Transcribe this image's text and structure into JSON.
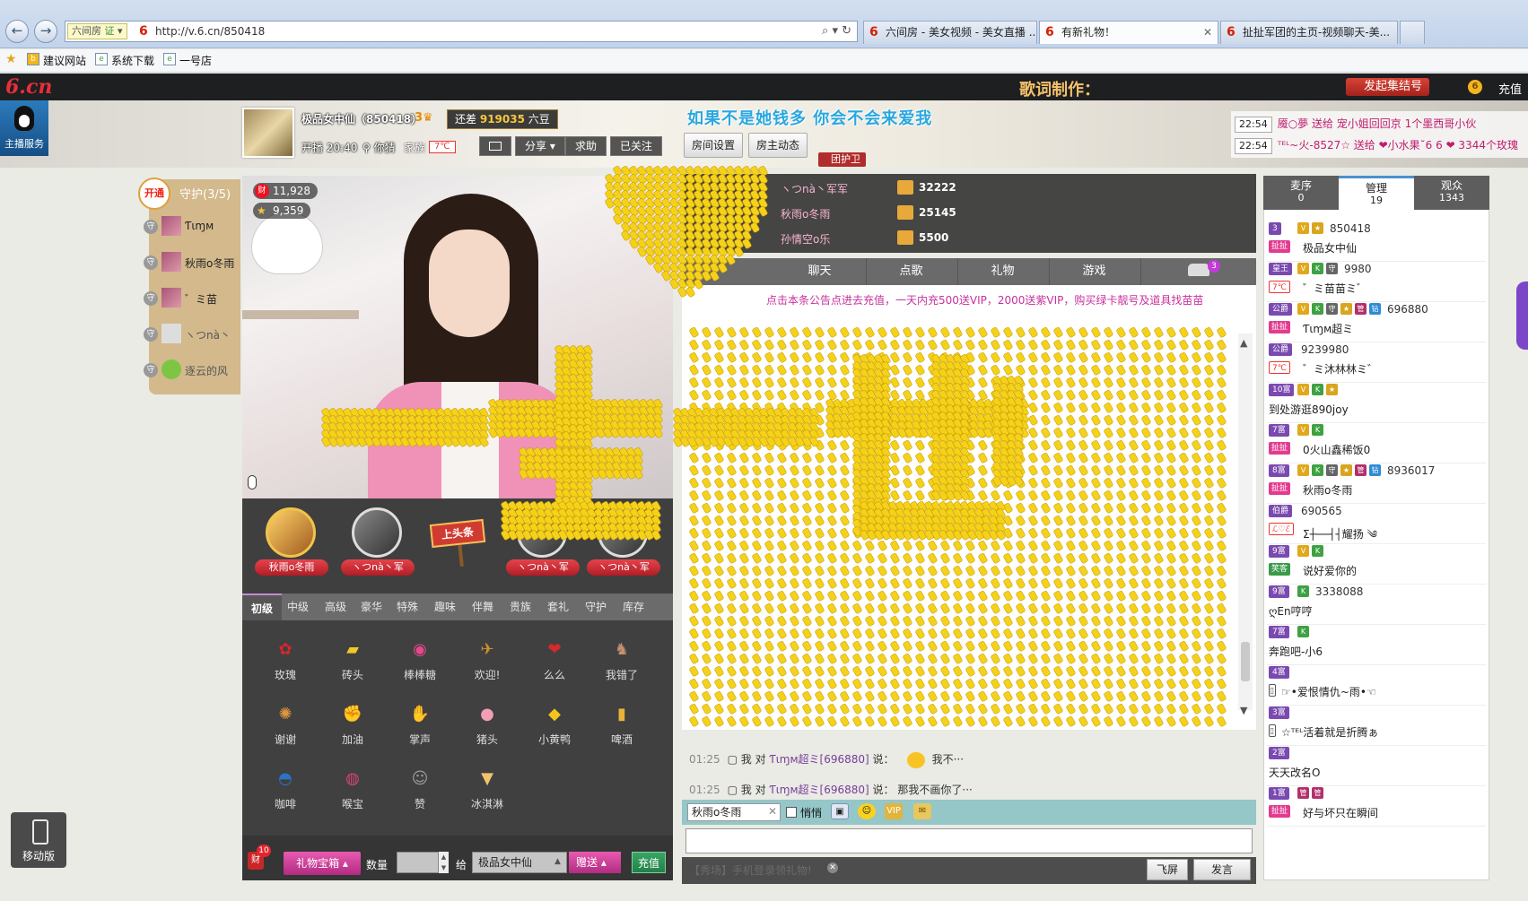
{
  "browser": {
    "site_badge": "六间房",
    "site_badge_extra": "证",
    "url": "http://v.6.cn/850418",
    "tabs": [
      {
        "title": "六间房 - 美女视频 - 美女直播 ...",
        "active": false
      },
      {
        "title": "有新礼物！",
        "active": true
      },
      {
        "title": "扯扯军团的主页-视频聊天-美...",
        "active": false
      }
    ],
    "favorites": [
      "建议网站",
      "系统下载",
      "一号店"
    ]
  },
  "header": {
    "logo": "6.cn",
    "lyrics_title": "歌词制作：",
    "rally_button": "发起集结号",
    "recharge": "充值"
  },
  "service_tab": "主播服务",
  "host": {
    "name": "极品女中仙（850418）",
    "level": "3",
    "gap_label": "还差",
    "gap_value": "919035",
    "gap_unit": "六豆",
    "live_time": "开播 20:40",
    "location": "你猜",
    "family_label": "家族",
    "family_badge": "7℃",
    "share": "分享",
    "ask": "求助",
    "followed": "已关注"
  },
  "marquee": "如果不是她钱多  你会不会来爱我",
  "room_buttons": {
    "settings": "房间设置",
    "dynamics": "房主动态",
    "guard": "团护卫"
  },
  "notices": [
    {
      "time": "22:54",
      "text": "魇○夢 送给 宠小姐回回京 1个墨西哥小伙"
    },
    {
      "time": "22:54",
      "text": "ᵀᴱᴸ~火-8527☆ 送给 ❤小水果˘6 6 ❤ 3344个玫瑰"
    }
  ],
  "guard": {
    "open": "开通",
    "title": "守护(3/5)",
    "members": [
      "Ƭιɱᴍ",
      "秋雨o冬雨",
      "゛ミ苗",
      "ヽつnà丶",
      "逐云的风"
    ]
  },
  "video_stats": {
    "wealth": "11,928",
    "stars": "9,359"
  },
  "rank_row": {
    "slots": [
      "秋雨o冬雨",
      "ヽつnà丶军",
      "ヽつnà丶军",
      "ヽつnà丶军"
    ],
    "headline": "上头条"
  },
  "gift_tabs": [
    "初级",
    "中级",
    "高级",
    "豪华",
    "特殊",
    "趣味",
    "伴舞",
    "贵族",
    "套礼",
    "守护",
    "库存"
  ],
  "gifts": [
    {
      "label": "玫瑰",
      "icon": "rose-icon",
      "glyph": "✿",
      "color": "#d8262c"
    },
    {
      "label": "砖头",
      "icon": "brick-icon",
      "glyph": "▰",
      "color": "#f2c823"
    },
    {
      "label": "棒棒糖",
      "icon": "lollipop-icon",
      "glyph": "◉",
      "color": "#e7488b"
    },
    {
      "label": "欢迎!",
      "icon": "welcome-icon",
      "glyph": "✈",
      "color": "#d0912b"
    },
    {
      "label": "么么",
      "icon": "kiss-icon",
      "glyph": "❤",
      "color": "#d42a2a"
    },
    {
      "label": "我错了",
      "icon": "sorry-icon",
      "glyph": "♞",
      "color": "#c59070"
    },
    {
      "label": "谢谢",
      "icon": "thanks-icon",
      "glyph": "✺",
      "color": "#e0943d"
    },
    {
      "label": "加油",
      "icon": "cheer-icon",
      "glyph": "✊",
      "color": "#d53b2a"
    },
    {
      "label": "掌声",
      "icon": "applause-icon",
      "glyph": "✋",
      "color": "#e3b27a"
    },
    {
      "label": "猪头",
      "icon": "pig-icon",
      "glyph": "●",
      "color": "#f29eb4"
    },
    {
      "label": "小黄鸭",
      "icon": "duck-icon",
      "glyph": "◆",
      "color": "#f3c51c"
    },
    {
      "label": "啤酒",
      "icon": "beer-icon",
      "glyph": "▮",
      "color": "#e8b13a"
    },
    {
      "label": "咖啡",
      "icon": "coffee-icon",
      "glyph": "◓",
      "color": "#2b73c9"
    },
    {
      "label": "喉宝",
      "icon": "lozenge-icon",
      "glyph": "◍",
      "color": "#d8427b"
    },
    {
      "label": "赞",
      "icon": "thumbs-up-icon",
      "glyph": "☺",
      "color": "#9c9c9c"
    },
    {
      "label": "冰淇淋",
      "icon": "icecream-icon",
      "glyph": "▼",
      "color": "#f1c36d"
    }
  ],
  "gift_bar": {
    "red_count": "10",
    "red_icon": "财",
    "treasure": "礼物宝箱",
    "qty_label": "数量",
    "to_label": "给",
    "recipient": "极品女中仙",
    "send": "赠送",
    "recharge": "充值"
  },
  "contributors": [
    {
      "name": "ヽつnà丶军军",
      "value": "32222"
    },
    {
      "name": "秋雨o冬雨",
      "value": "25145"
    },
    {
      "name": "孙情空o乐",
      "value": "5500"
    }
  ],
  "chat_tabs": [
    "聊天",
    "点歌",
    "礼物",
    "游戏"
  ],
  "car_count": "3",
  "chat_notice": "点击本条公告点进去充值，一天内充500送VIP，2000送紫VIP，购买绿卡靓号及道具找苗苗",
  "chat_messages": [
    {
      "time": "01:25",
      "me": "我 对",
      "user": "Ƭιɱᴍ超ミ",
      "uid": "[696880]",
      "say": "说：",
      "text": "我不···",
      "emoji": true
    },
    {
      "time": "01:25",
      "me": "我 对",
      "user": "Ƭιɱᴍ超ミ",
      "uid": "[696880]",
      "say": "说：",
      "text": "那我不画你了···",
      "emoji": false
    }
  ],
  "input": {
    "target": "秋雨o冬雨",
    "whisper": "悄悄",
    "mobile_login": "【秀场】手机登录领礼物!",
    "flyscreen": "飞屏",
    "speak": "发言"
  },
  "gift_animation": {
    "caption": "一生一世"
  },
  "user_tabs": [
    {
      "label": "麦序",
      "count": "0"
    },
    {
      "label": "管理",
      "count": "19",
      "active": true
    },
    {
      "label": "观众",
      "count": "1343"
    }
  ],
  "users": [
    {
      "level": "3",
      "badges": [
        "V",
        "★"
      ],
      "uid": "850418",
      "family": "扯扯",
      "name": "极品女中仙"
    },
    {
      "level": "皇王",
      "badges": [
        "V",
        "K",
        "守"
      ],
      "uid": "9980",
      "family": "7℃",
      "name": "゛ミ苗苗ミ゛"
    },
    {
      "level": "公爵",
      "badges": [
        "V",
        "K",
        "守",
        "★",
        "管",
        "钻"
      ],
      "uid": "696880",
      "family": "扯扯",
      "name": "Ƭιɱᴍ超ミ"
    },
    {
      "level": "公爵",
      "badges": [],
      "uid": "9239980",
      "family": "7℃",
      "name": "゛ミ沐林林ミ゛"
    },
    {
      "level": "10富",
      "badges": [
        "V",
        "K",
        "★"
      ],
      "uid": "",
      "family": "",
      "name": "到处游逛890joy"
    },
    {
      "level": "7富",
      "badges": [
        "V",
        "K"
      ],
      "uid": "",
      "family": "扯扯",
      "name": "0火山鑫稀饭0"
    },
    {
      "level": "8富",
      "badges": [
        "V",
        "K",
        "守",
        "★",
        "管",
        "钻"
      ],
      "uid": "8936017",
      "family": "扯扯",
      "name": "秋雨o冬雨"
    },
    {
      "level": "伯爵",
      "badges": [],
      "uid": "690565",
      "family": "ℒ♡ℰ",
      "name": "Σ┼──┤┤耀扬 ༄"
    },
    {
      "level": "9富",
      "badges": [
        "V",
        "K"
      ],
      "uid": "",
      "family": "笑客",
      "name": "说好爱你的"
    },
    {
      "level": "9富",
      "badges": [
        "K"
      ],
      "uid": "3338088",
      "family": "",
      "name": "ღEn哼哼"
    },
    {
      "level": "7富",
      "badges": [
        "K"
      ],
      "uid": "",
      "family": "",
      "name": "奔跑吧-小6"
    },
    {
      "level": "4富",
      "badges": [],
      "uid": "",
      "family": "▯",
      "name": "☞•爱恨情仇~雨•☜"
    },
    {
      "level": "3富",
      "badges": [],
      "uid": "",
      "family": "▯",
      "name": "☆ᵀᴱᴸ活着就是折腾ぁ"
    },
    {
      "level": "2富",
      "badges": [],
      "uid": "",
      "family": "",
      "name": "天天改名O"
    },
    {
      "level": "1富",
      "badges": [
        "管",
        "管"
      ],
      "uid": "",
      "family": "扯扯",
      "name": "好与坏只在瞬间"
    }
  ],
  "mobile_version": "移动版"
}
